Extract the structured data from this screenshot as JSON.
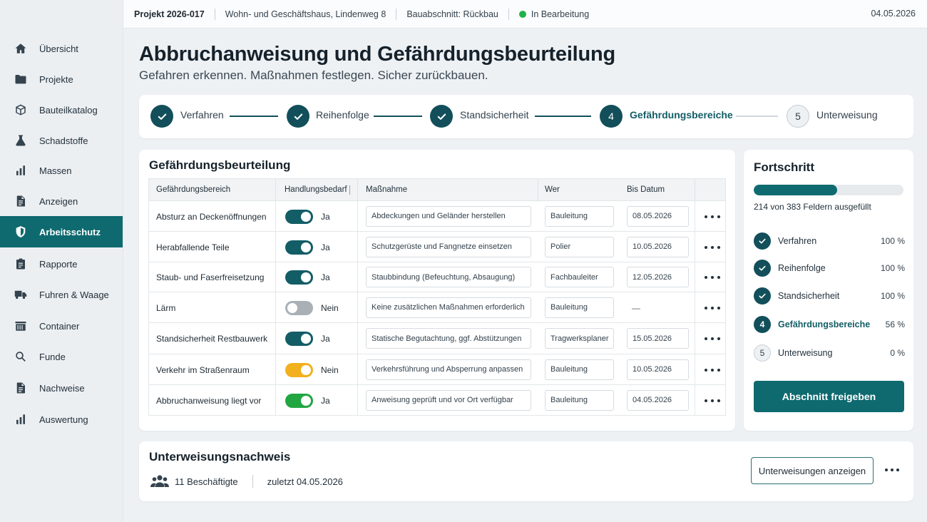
{
  "topbar": {
    "project": "Projekt 2026-017",
    "building": "Wohn- und Geschäftshaus, Lindenweg 8",
    "phase": "Bauabschnitt: Rückbau",
    "status": "In Bearbeitung",
    "status_color": "#1fb24a",
    "date": "04.05.2026"
  },
  "sidebar": {
    "items": [
      {
        "label": "Übersicht",
        "icon": "home-icon"
      },
      {
        "label": "Projekte",
        "icon": "folder-icon"
      },
      {
        "label": "Bauteilkatalog",
        "icon": "cube-icon"
      },
      {
        "label": "Schadstoffe",
        "icon": "flask-icon"
      },
      {
        "label": "Massen",
        "icon": "bar-chart-icon"
      },
      {
        "label": "Anzeigen",
        "icon": "document-icon"
      },
      {
        "label": "Arbeitsschutz",
        "icon": "shield-icon",
        "active": true
      },
      {
        "label": "Rapporte",
        "icon": "clipboard-icon"
      },
      {
        "label": "Fuhren & Waage",
        "icon": "truck-icon"
      },
      {
        "label": "Container",
        "icon": "container-icon"
      },
      {
        "label": "Funde",
        "icon": "search-icon"
      },
      {
        "label": "Nachweise",
        "icon": "document-icon"
      },
      {
        "label": "Auswertung",
        "icon": "bar-chart-icon"
      }
    ]
  },
  "header": {
    "title": "Abbruchanweisung und Gefährdungsbeurteilung",
    "subtitle": "Gefahren erkennen. Maßnahmen festlegen. Sicher zurückbauen."
  },
  "stepper": {
    "steps": [
      {
        "number": "1",
        "label": "Verfahren",
        "state": "done"
      },
      {
        "number": "2",
        "label": "Reihenfolge",
        "state": "done"
      },
      {
        "number": "3",
        "label": "Standsicherheit",
        "state": "done"
      },
      {
        "number": "4",
        "label": "Gefährdungsbereiche",
        "state": "current"
      },
      {
        "number": "5",
        "label": "Unterweisung",
        "state": "pending"
      }
    ]
  },
  "assessment": {
    "title": "Gefährdungsbeurteilung",
    "columns": {
      "area": "Gefährdungsbereich",
      "need": "Handlungsbedarf",
      "measure": "Maßnahme",
      "who": "Wer",
      "due": "Bis Datum"
    },
    "rows": [
      {
        "area": "Absturz an Deckenöffnungen",
        "need": "Ja",
        "on": true,
        "toggle_color": "#125d66",
        "measure": "Abdeckungen und Geländer herstellen",
        "who": "Bauleitung",
        "due": "08.05.2026"
      },
      {
        "area": "Herabfallende Teile",
        "need": "Ja",
        "on": true,
        "toggle_color": "#125d66",
        "measure": "Schutzgerüste und Fangnetze einsetzen",
        "who": "Polier",
        "due": "10.05.2026"
      },
      {
        "area": "Staub- und Faserfreisetzung",
        "need": "Ja",
        "on": true,
        "toggle_color": "#125d66",
        "measure": "Staubbindung (Befeuchtung, Absaugung)",
        "who": "Fachbauleiter",
        "due": "12.05.2026"
      },
      {
        "area": "Lärm",
        "need": "Nein",
        "on": false,
        "toggle_color": "#a9b0b6",
        "measure": "Keine zusätzlichen Maßnahmen erforderlich",
        "who": "Bauleitung",
        "due": "—"
      },
      {
        "area": "Standsicherheit Restbauwerk",
        "need": "Ja",
        "on": true,
        "toggle_color": "#125d66",
        "measure": "Statische Begutachtung, ggf. Abstützungen",
        "who": "Tragwerksplaner",
        "due": "15.05.2026"
      },
      {
        "area": "Verkehr im Straßenraum",
        "need": "Nein",
        "on": true,
        "toggle_color": "#f2b01e",
        "measure": "Verkehrsführung und Absperrung anpassen",
        "who": "Bauleitung",
        "due": "10.05.2026"
      },
      {
        "area": "Abbruchanweisung liegt vor",
        "need": "Ja",
        "on": true,
        "toggle_color": "#21a641",
        "measure": "Anweisung geprüft und vor Ort verfügbar",
        "who": "Bauleitung",
        "due": "04.05.2026"
      }
    ]
  },
  "progress": {
    "title": "Fortschritt",
    "filled": 214,
    "total": 383,
    "caption": "214 von 383 Feldern ausgefüllt",
    "items": [
      {
        "number": "1",
        "label": "Verfahren",
        "percent": "100 %",
        "state": "done"
      },
      {
        "number": "2",
        "label": "Reihenfolge",
        "percent": "100 %",
        "state": "done"
      },
      {
        "number": "3",
        "label": "Standsicherheit",
        "percent": "100 %",
        "state": "done"
      },
      {
        "number": "4",
        "label": "Gefährdungsbereiche",
        "percent": "56 %",
        "state": "current"
      },
      {
        "number": "5",
        "label": "Unterweisung",
        "percent": "0 %",
        "state": "pending"
      }
    ],
    "button": "Abschnitt freigeben"
  },
  "training": {
    "title": "Unterweisungsnachweis",
    "employees": "11 Beschäftigte",
    "last": "zuletzt 04.05.2026",
    "button": "Unterweisungen anzeigen"
  },
  "colors": {
    "accent": "#0e6a6f",
    "accent_dark": "#124f5a"
  }
}
